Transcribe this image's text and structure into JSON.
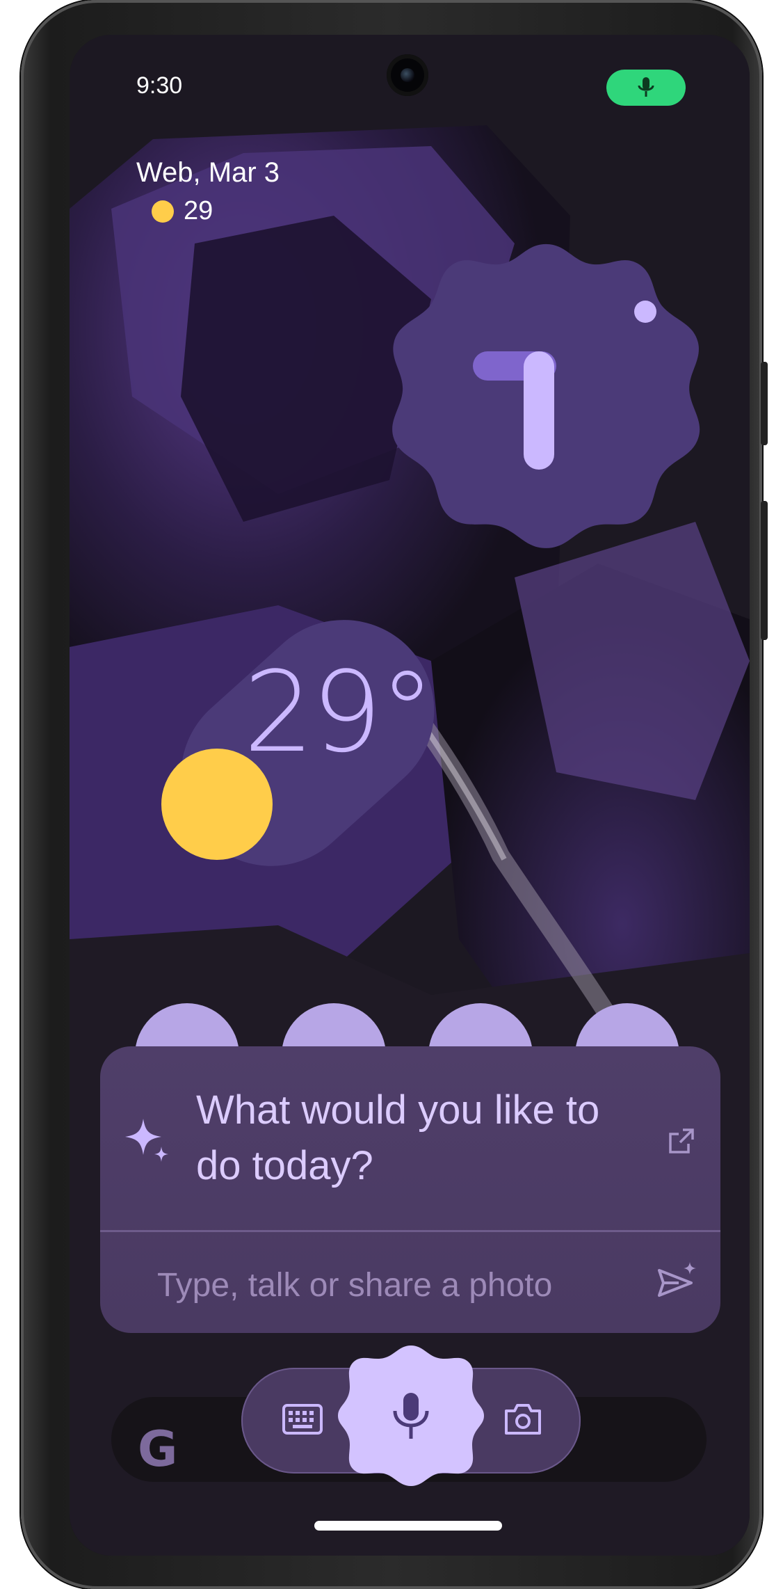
{
  "status_bar": {
    "time": "9:30",
    "mic_indicator_icon": "mic-icon",
    "mic_indicator_color": "#2fd67b"
  },
  "at_a_glance": {
    "date": "Web, Mar 3",
    "temperature": "29",
    "weather_icon": "sun-icon"
  },
  "clock_widget": {
    "hour_hand_icon": "clock-hand-icon"
  },
  "weather_widget": {
    "temperature": "29°",
    "condition_icon": "sun-icon"
  },
  "assistant_overlay": {
    "prompt": "What would you like to do today?",
    "input_placeholder": "Type, talk or share a photo",
    "sparkle_icon": "sparkle-icon",
    "open_full_icon": "open-in-new-icon",
    "send_icon": "send-icon"
  },
  "input_controls": {
    "keyboard_icon": "keyboard-icon",
    "mic_icon": "mic-icon",
    "camera_icon": "camera-icon"
  },
  "search_bar": {
    "logo_text": "G"
  },
  "colors": {
    "accent_purple": "#cbb8ff",
    "widget_bg": "#4b3a78",
    "sun_yellow": "#ffcd4a",
    "card_bg": "#4f3e69",
    "mic_blob": "#d3c3ff"
  }
}
